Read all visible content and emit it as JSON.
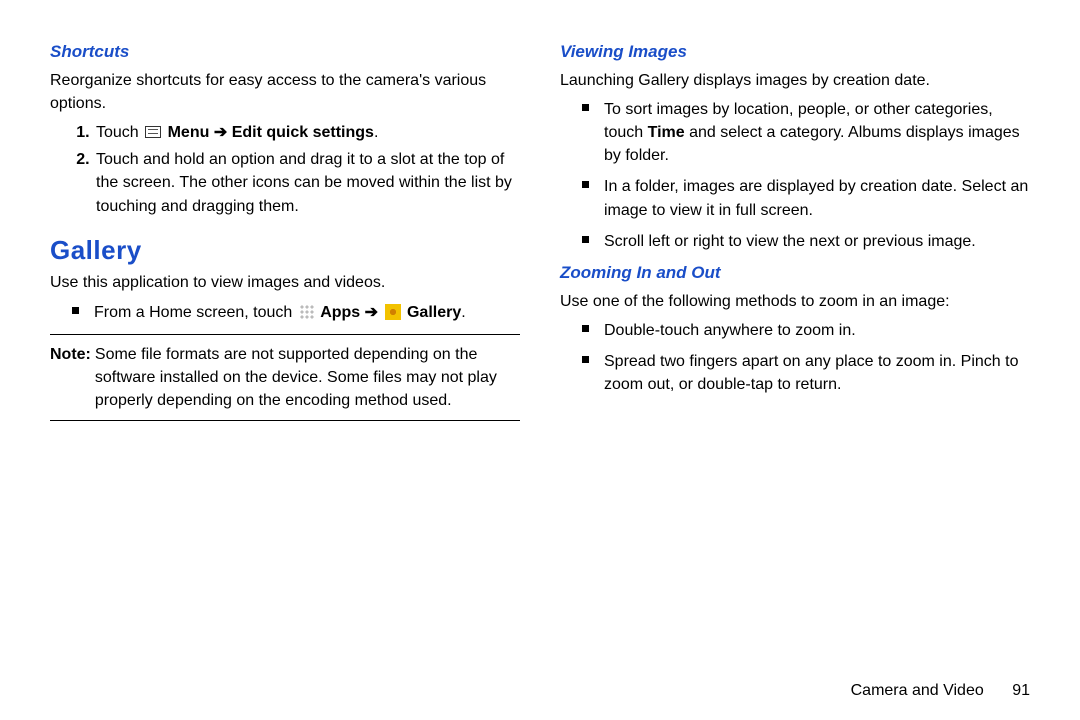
{
  "left": {
    "shortcuts_head": "Shortcuts",
    "shortcuts_desc": "Reorganize shortcuts for easy access to the camera's various options.",
    "step1_prefix": "Touch ",
    "step1_menu": "Menu",
    "step1_arrow": "➔",
    "step1_suffix": "Edit quick settings",
    "step1_end": ".",
    "step2": "Touch and hold an option and drag it to a slot at the top of the screen. The other icons can be moved within the list by touching and dragging them.",
    "gallery_head": "Gallery",
    "gallery_desc": "Use this application to view images and videos.",
    "bullet_prefix": "From a Home screen, touch ",
    "bullet_apps": "Apps",
    "bullet_arrow": "➔",
    "bullet_gallery": "Gallery",
    "bullet_end": ".",
    "note_label": "Note:",
    "note_text": "Some file formats are not supported depending on the software installed on the device. Some files may not play properly depending on the encoding method used."
  },
  "right": {
    "viewing_head": "Viewing Images",
    "viewing_desc": "Launching Gallery displays images by creation date.",
    "vb1a": "To sort images by location, people, or other categories, touch ",
    "vb1_time": "Time",
    "vb1b": " and select a category. Albums displays images by folder.",
    "vb2": "In a folder, images are displayed by creation date. Select an image to view it in full screen.",
    "vb3": "Scroll left or right to view the next or previous image.",
    "zoom_head": "Zooming In and Out",
    "zoom_desc": "Use one of the following methods to zoom in an image:",
    "zb1": "Double-touch anywhere to zoom in.",
    "zb2": "Spread two fingers apart on any place to zoom in. Pinch to zoom out, or double-tap to return."
  },
  "footer": {
    "section": "Camera and Video",
    "page": "91"
  }
}
